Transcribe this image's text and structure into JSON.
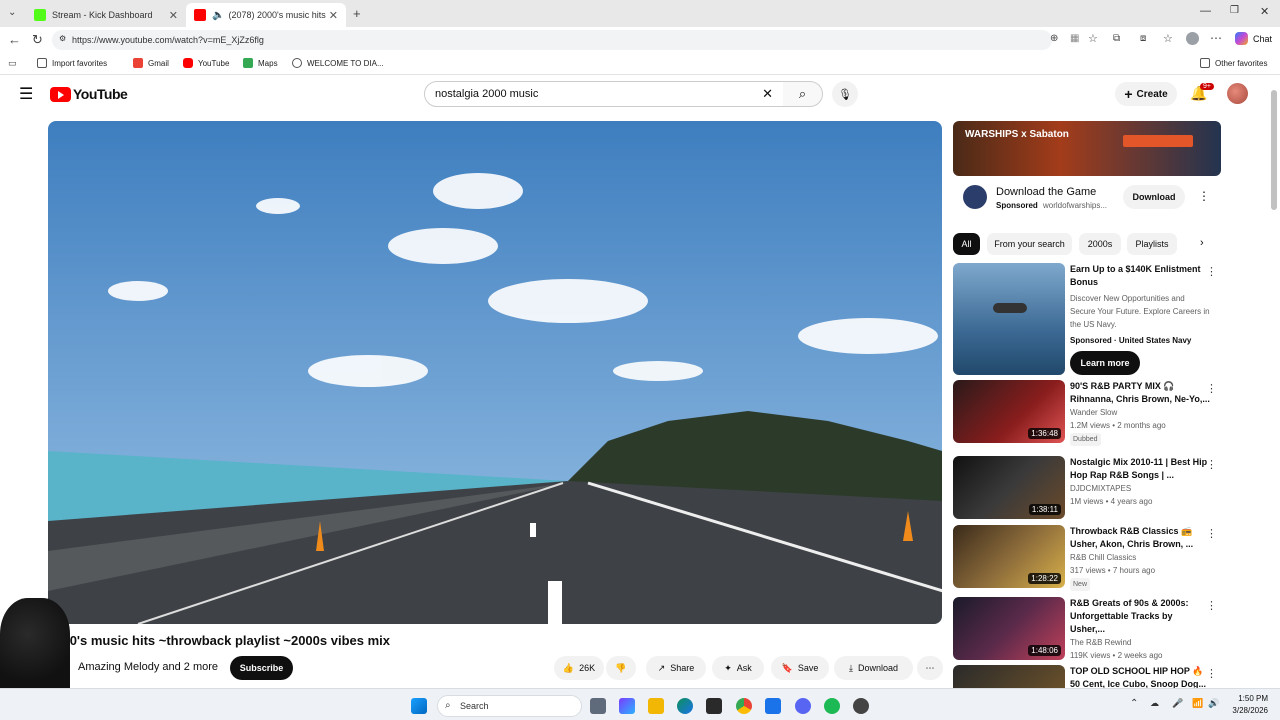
{
  "browser": {
    "tabs": [
      {
        "title": "Stream - Kick Dashboard",
        "active": false
      },
      {
        "title": "(2078) 2000's music hits ~thro",
        "active": true
      }
    ],
    "url": "https://www.youtube.com/watch?v=mE_XjZz6flg",
    "copilot_label": "Chat",
    "favorites": [
      {
        "label": "Import favorites",
        "icon": "folder-icon"
      },
      {
        "label": "Gmail",
        "icon": "gmail-icon"
      },
      {
        "label": "YouTube",
        "icon": "youtube-icon"
      },
      {
        "label": "Maps",
        "icon": "maps-icon"
      },
      {
        "label": "WELCOME TO DIA...",
        "icon": "globe-icon"
      }
    ],
    "other_favorites": "Other favorites"
  },
  "youtube": {
    "logo_text": "YouTube",
    "search_value": "nostalgia 2000 music",
    "create_label": "Create",
    "notif_badge": "9+"
  },
  "video": {
    "title": "2000's music hits ~throwback playlist ~2000s vibes mix",
    "channel": "Amazing Melody and 2 more",
    "subscribe_label": "Subscribe",
    "likes": "26K",
    "share_label": "Share",
    "ask_label": "Ask",
    "save_label": "Save",
    "download_label": "Download"
  },
  "ad": {
    "banner_text": "WARSHIPS x Sabaton",
    "title": "Download the Game",
    "sponsored": "Sponsored",
    "domain": "worldofwarships...",
    "button": "Download"
  },
  "chips": [
    "All",
    "From your search",
    "2000s",
    "Playlists"
  ],
  "sidebar_videos": [
    {
      "title": "Earn Up to a $140K Enlistment Bonus",
      "line1": "Discover New Opportunities and Secure Your Future. Explore Careers in the US Navy.",
      "line2": "Sponsored · United States Navy",
      "cta": "Learn more",
      "duration": ""
    },
    {
      "title": "90'S R&B PARTY MIX 🎧 Rihnanna, Chris Brown, Ne-Yo,...",
      "line1": "Wander Slow",
      "line2": "1.2M views • 2 months ago",
      "badge": "Dubbed",
      "duration": "1:36:48"
    },
    {
      "title": "Nostalgic Mix 2010-11 | Best Hip Hop Rap R&B Songs | ...",
      "line1": "DJDCMIXTAPES",
      "line2": "1M views • 4 years ago",
      "duration": "1:38:11"
    },
    {
      "title": "Throwback R&B Classics 📻 Usher, Akon, Chris Brown, ...",
      "line1": "R&B Chill Classics",
      "line2": "317 views • 7 hours ago",
      "badge": "New",
      "duration": "1:28:22"
    },
    {
      "title": "R&B Greats of 90s & 2000s: Unforgettable Tracks by Usher,...",
      "line1": "The R&B Rewind",
      "line2": "119K views • 2 weeks ago",
      "duration": "1:48:06"
    },
    {
      "title": "TOP OLD SCHOOL HIP HOP 🔥 50 Cent, Ice Cubo, Snoop Dog...",
      "line1": "",
      "line2": "",
      "duration": ""
    }
  ],
  "taskbar": {
    "search_placeholder": "Search",
    "time": "1:50 PM",
    "date": "3/28/2026"
  },
  "colors": {
    "youtube_red": "#ff0000",
    "accent_blue": "#0b57d0"
  }
}
